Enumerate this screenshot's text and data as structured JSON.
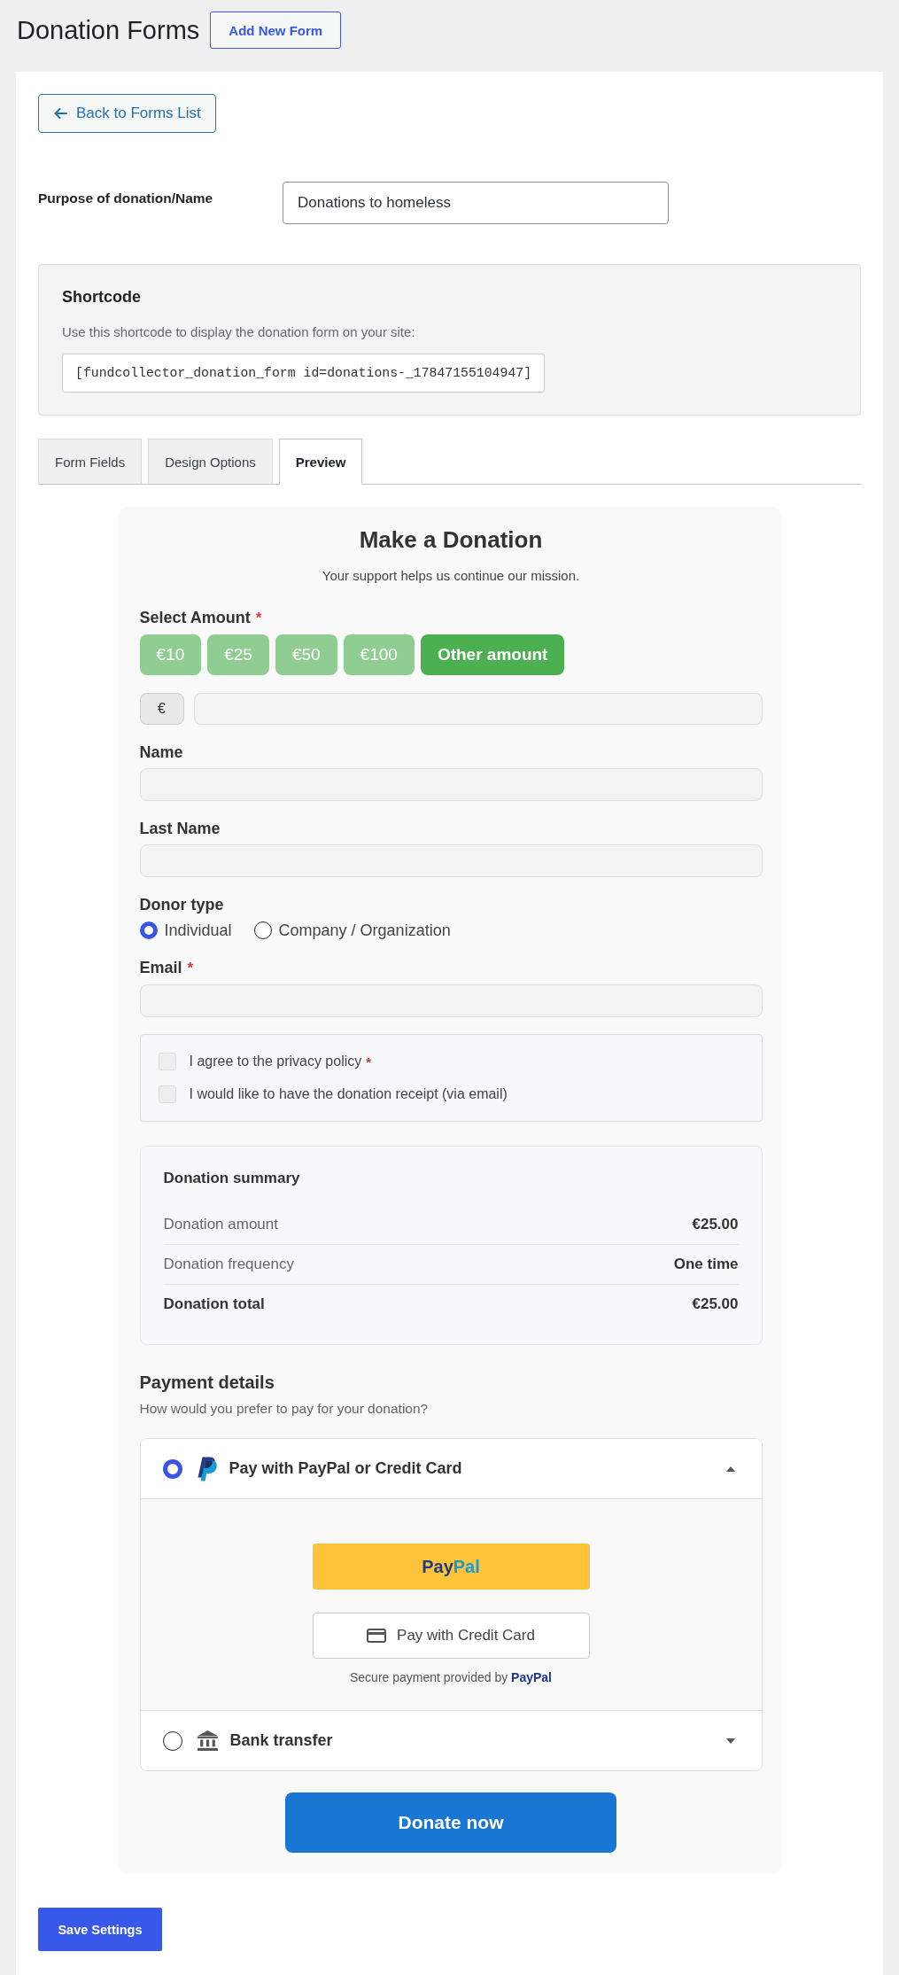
{
  "header": {
    "title": "Donation Forms",
    "add_button": "Add New Form"
  },
  "back_button": "Back to Forms List",
  "purpose": {
    "label": "Purpose of donation/Name",
    "value": "Donations to homeless"
  },
  "shortcode": {
    "title": "Shortcode",
    "description": "Use this shortcode to display the donation form on your site:",
    "code": "[fundcollector_donation_form id=donations-_17847155104947]"
  },
  "tabs": [
    {
      "label": "Form Fields",
      "selected": false
    },
    {
      "label": "Design Options",
      "selected": false
    },
    {
      "label": "Preview",
      "selected": true
    }
  ],
  "preview": {
    "title": "Make a Donation",
    "subtitle": "Your support helps us continue our mission.",
    "amount": {
      "label": "Select Amount",
      "required_mark": "*",
      "options": [
        {
          "label": "€10",
          "selected": false
        },
        {
          "label": "€25",
          "selected": false
        },
        {
          "label": "€50",
          "selected": false
        },
        {
          "label": "€100",
          "selected": false
        },
        {
          "label": "Other amount",
          "selected": true
        }
      ],
      "currency": "€"
    },
    "fields": [
      {
        "label": "Name"
      },
      {
        "label": "Last Name"
      }
    ],
    "donor_type": {
      "label": "Donor type",
      "options": [
        {
          "label": "Individual",
          "selected": true
        },
        {
          "label": "Company / Organization",
          "selected": false
        }
      ]
    },
    "email": {
      "label": "Email",
      "required_mark": "*"
    },
    "consents": [
      {
        "label": "I agree to the privacy policy",
        "required_mark": "*",
        "checked": false
      },
      {
        "label": "I would like to have the donation receipt (via email)",
        "checked": false
      }
    ],
    "summary": {
      "title": "Donation summary",
      "rows": [
        {
          "label": "Donation amount",
          "value": "€25.00",
          "kind": "item"
        },
        {
          "label": "Donation frequency",
          "value": "One time",
          "kind": "item"
        },
        {
          "label": "Donation total",
          "value": "€25.00",
          "kind": "total"
        }
      ]
    },
    "payment": {
      "title": "Payment details",
      "subtitle": "How would you prefer to pay for your donation?",
      "methods": [
        {
          "kind": "paypal",
          "label": "Pay with PayPal or Credit Card",
          "selected": true,
          "expanded": true,
          "panel": {
            "paypal_button": [
              {
                "text": "Pay",
                "kind": "dark"
              },
              {
                "text": "Pal",
                "kind": "light"
              }
            ],
            "card_button": "Pay with Credit Card",
            "secure_text": "Secure payment provided by **PayPal**"
          }
        },
        {
          "kind": "bank",
          "label": "Bank transfer",
          "selected": false,
          "expanded": false
        }
      ]
    },
    "donate_button": "Donate now"
  },
  "save_button": "Save Settings"
}
